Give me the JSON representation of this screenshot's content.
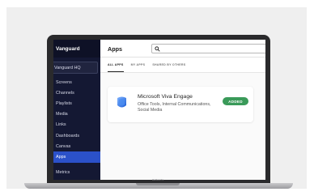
{
  "device": {
    "base_label": "MacBook Pro"
  },
  "sidebar": {
    "brand": "Vanguard",
    "org_selector": "Vanguard HQ",
    "items": [
      {
        "label": "Screens",
        "active": false
      },
      {
        "label": "Channels",
        "active": false
      },
      {
        "label": "Playlists",
        "active": false
      },
      {
        "label": "Media",
        "active": false
      },
      {
        "label": "Links",
        "active": false
      },
      {
        "label": "Dashboards",
        "active": false
      },
      {
        "label": "Canvas",
        "active": false
      },
      {
        "label": "Apps",
        "active": true
      }
    ],
    "bottom_item": "Metrics",
    "colors": {
      "background": "#141833",
      "active": "#2b51c9"
    }
  },
  "header": {
    "title": "Apps",
    "search_placeholder": ""
  },
  "tabs": [
    {
      "label": "ALL APPS",
      "active": true
    },
    {
      "label": "MY APPS",
      "active": false
    },
    {
      "label": "SHARED BY OTHERS",
      "active": false
    }
  ],
  "app_card": {
    "name": "Microsoft Viva Engage",
    "categories": "Office Tools, Internal Communications, Social Media",
    "badge": "ADDED",
    "icon": "viva-engage-icon",
    "badge_color": "#3a9a59"
  }
}
